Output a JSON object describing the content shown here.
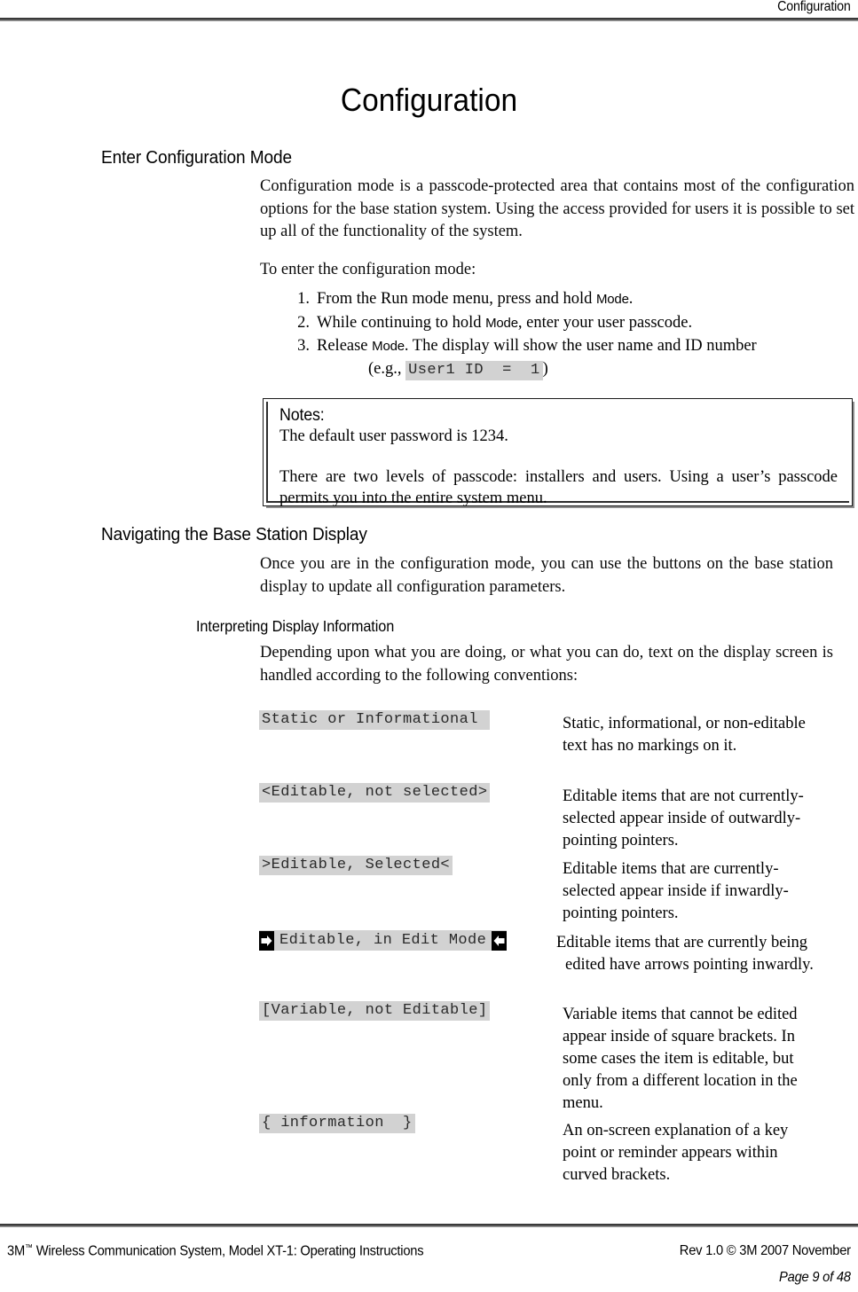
{
  "header": {
    "running_title": "Configuration"
  },
  "page_title": "Configuration",
  "sections": {
    "enter_config": {
      "heading": "Enter Configuration Mode",
      "para1": "Configuration mode is a passcode-protected area that contains most of the configuration options for the base station system.  Using the access provided for users it is possible to set up all of the functionality of the system.",
      "para2": "To enter the configuration mode:",
      "steps": [
        {
          "num": "1.",
          "text_before": "From the Run mode menu, press and hold ",
          "key": "Mode",
          "text_after": "."
        },
        {
          "num": "2.",
          "text_before": "While continuing to hold ",
          "key": "Mode",
          "text_after": ", enter your user passcode."
        },
        {
          "num": "3.",
          "text_before": "Release ",
          "key": "Mode",
          "text_after": ".  The display will show the user name and ID number"
        }
      ],
      "step3_example_prefix": "(e.g., ",
      "step3_example_code": "User1 ID  =  1",
      "step3_example_suffix": ")"
    },
    "notes": {
      "title": "Notes:",
      "line1": "The default user password is 1234.",
      "line2": "There are two levels of passcode: installers and users.  Using a user’s passcode permits you into the entire system menu."
    },
    "navigating": {
      "heading": "Navigating the Base Station Display",
      "para1": "Once you are in the configuration mode, you can use the buttons on the base station display to update all configuration parameters."
    },
    "interpreting": {
      "heading": "Interpreting Display Information",
      "para1": "Depending upon what you are doing, or what you can do, text on the display screen is handled according to the following conventions:"
    }
  },
  "conventions": [
    {
      "example": "Static or Informational ",
      "description": "Static, informational, or non-editable text has no markings on it.",
      "style": "plain"
    },
    {
      "example": "<Editable, not selected>",
      "description": "Editable items that are not currently-selected appear inside of outwardly-pointing pointers.",
      "style": "plain"
    },
    {
      "example": ">Editable, Selected<",
      "description": "Editable items that are currently-selected appear inside if inwardly-pointing pointers.",
      "style": "plain"
    },
    {
      "example": "Editable, in Edit Mode",
      "description": "Editable items that are currently being edited have arrows pointing inwardly.",
      "style": "edit-arrows",
      "left_icon": "arrow-right-inward-icon",
      "right_icon": "arrow-left-inward-icon"
    },
    {
      "example": "[Variable, not Editable]",
      "description": "Variable items that cannot be edited appear inside of square brackets.  In some cases the item is editable, but only from a different location in the menu.",
      "style": "plain"
    },
    {
      "example": "{ information  }",
      "description": "An on-screen explanation of a key point or reminder appears within curved brackets.",
      "style": "plain"
    }
  ],
  "footer": {
    "left_pre": "3M",
    "left_tm": "™",
    "left_post": " Wireless Communication System, Model XT-1: Operating Instructions",
    "right": "Rev 1.0 © 3M 2007 November",
    "page": "Page 9 of 48"
  },
  "colors": {
    "code_background": "#d2d2d2",
    "rule": "#3a3a3a",
    "text": "#000000"
  }
}
